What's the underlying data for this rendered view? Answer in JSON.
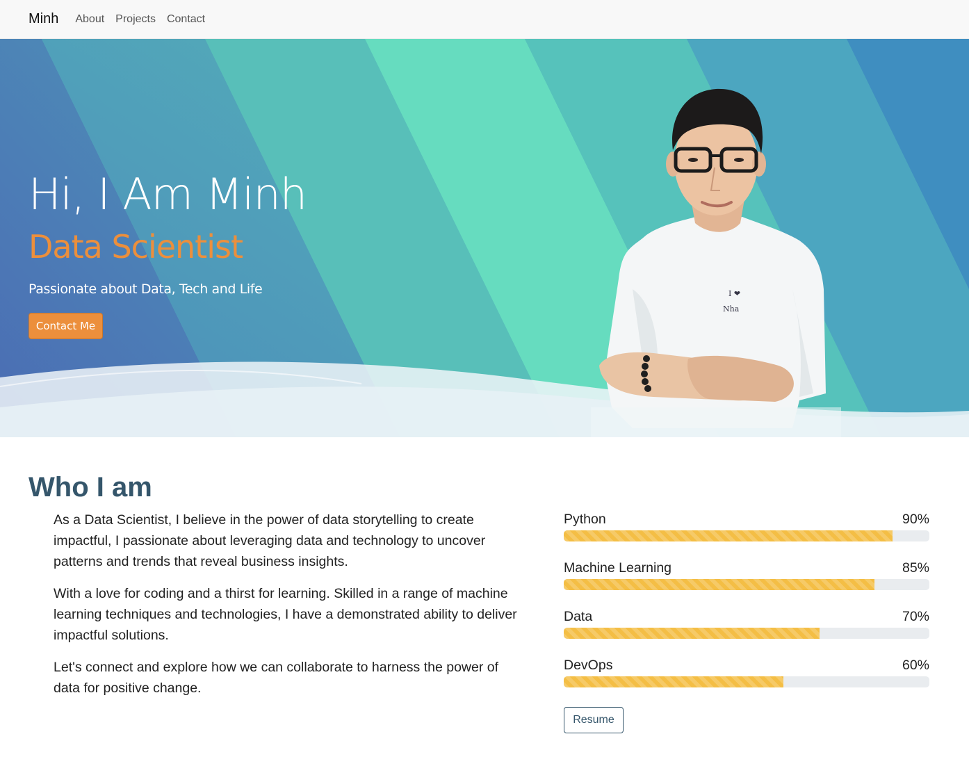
{
  "nav": {
    "brand": "Minh",
    "links": [
      "About",
      "Projects",
      "Contact"
    ]
  },
  "hero": {
    "title": "Hi, I Am Minh",
    "subtitle": "Data Scientist",
    "tagline": "Passionate about Data, Tech and Life",
    "cta_label": "Contact Me",
    "colors": {
      "accent": "#ec8f3c",
      "stripe_blue": "#4a6fb6",
      "stripe_mint": "#66dcbf",
      "stripe_teal": "#56bfb8"
    }
  },
  "about": {
    "title": "Who I am",
    "paragraphs": [
      "As a Data Scientist, I believe in the power of data storytelling to create impactful, I passionate about leveraging data and technology to uncover patterns and trends that reveal business insights.",
      "With a love for coding and a thirst for learning. Skilled in a range of machine learning techniques and technologies, I have a demonstrated ability to deliver impactful solutions.",
      "Let's connect and explore how we can collaborate to harness the power of data for positive change."
    ]
  },
  "skills": [
    {
      "name": "Python",
      "percent_label": "90%",
      "value": 0.9
    },
    {
      "name": "Machine Learning",
      "percent_label": "85%",
      "value": 0.85
    },
    {
      "name": "Data",
      "percent_label": "70%",
      "value": 0.7
    },
    {
      "name": "DevOps",
      "percent_label": "60%",
      "value": 0.6
    }
  ],
  "resume_label": "Resume",
  "colors": {
    "heading": "#35566b",
    "skill_bar": "#f4be45",
    "skill_track": "#e9ecef"
  }
}
